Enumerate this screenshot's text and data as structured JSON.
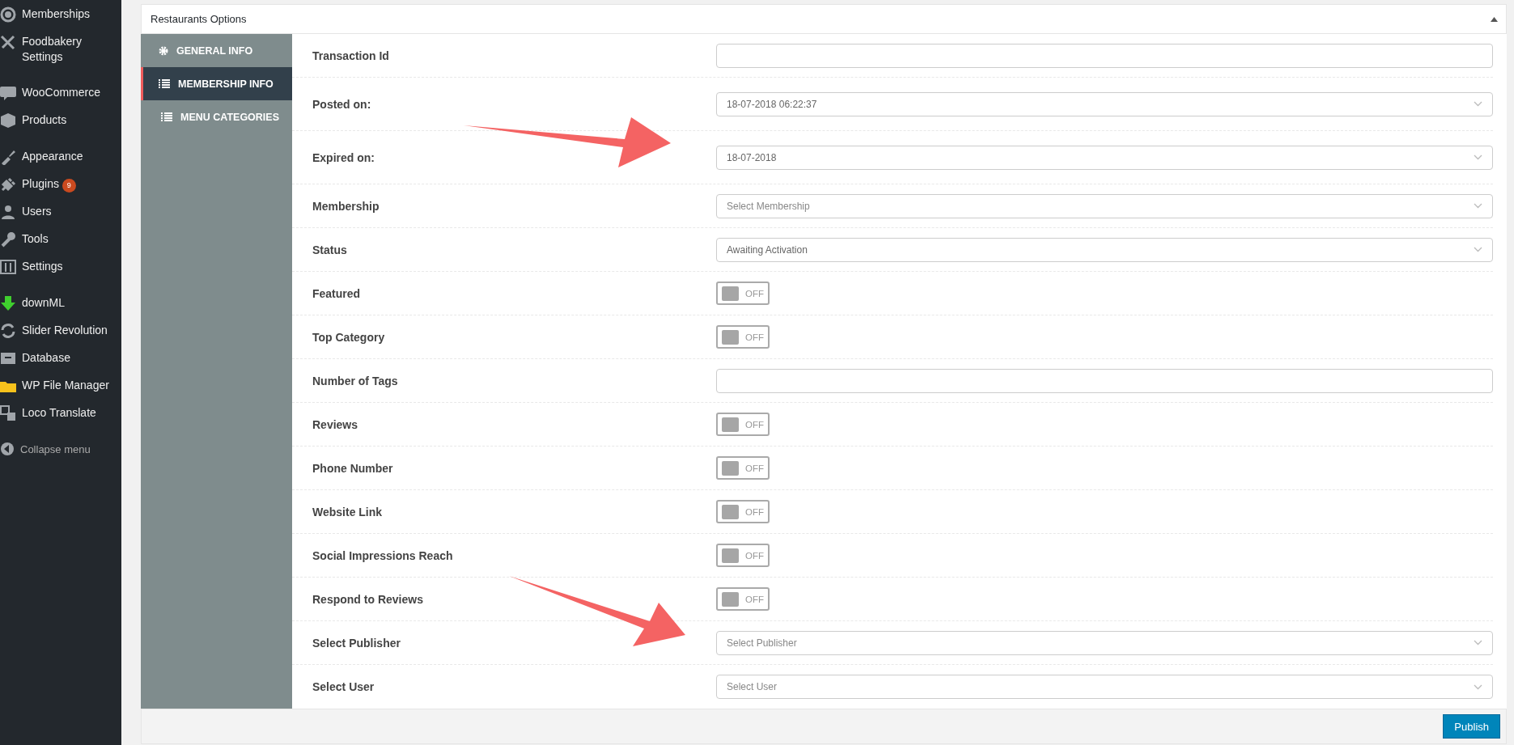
{
  "sidebar": {
    "groups": [
      [
        {
          "label": "Memberships"
        },
        {
          "label": "Foodbakery Settings"
        }
      ],
      [
        {
          "label": "WooCommerce"
        },
        {
          "label": "Products"
        }
      ],
      [
        {
          "label": "Appearance"
        },
        {
          "label": "Plugins",
          "badge": "9"
        },
        {
          "label": "Users"
        },
        {
          "label": "Tools"
        },
        {
          "label": "Settings"
        }
      ],
      [
        {
          "label": "downML"
        },
        {
          "label": "Slider Revolution"
        },
        {
          "label": "Database"
        },
        {
          "label": "WP File Manager"
        },
        {
          "label": "Loco Translate"
        }
      ]
    ],
    "collapse": "Collapse menu"
  },
  "panel": {
    "title": "Restaurants Options",
    "expanded": true,
    "tabs": [
      {
        "label": "GENERAL INFO",
        "selected": false
      },
      {
        "label": "MEMBERSHIP INFO",
        "selected": true
      },
      {
        "label": "MENU CATEGORIES",
        "selected": false
      }
    ],
    "rows": [
      {
        "kind": "text",
        "label": "Transaction Id"
      },
      {
        "kind": "select",
        "label": "Posted on:",
        "value": "18-07-2018 06:22:37"
      },
      {
        "kind": "select",
        "label": "Expired on:",
        "value": "18-07-2018"
      },
      {
        "kind": "select",
        "label": "Membership",
        "placeholder": "Select Membership"
      },
      {
        "kind": "select",
        "label": "Status",
        "value": "Awaiting Activation"
      },
      {
        "kind": "toggle",
        "label": "Featured",
        "on": false,
        "state_label": "OFF"
      },
      {
        "kind": "toggle",
        "label": "Top Category",
        "on": false,
        "state_label": "OFF"
      },
      {
        "kind": "text",
        "label": "Number of Tags"
      },
      {
        "kind": "toggle",
        "label": "Reviews",
        "on": false,
        "state_label": "OFF"
      },
      {
        "kind": "toggle",
        "label": "Phone Number",
        "on": false,
        "state_label": "OFF"
      },
      {
        "kind": "toggle",
        "label": "Website Link",
        "on": false,
        "state_label": "OFF"
      },
      {
        "kind": "toggle",
        "label": "Social Impressions Reach",
        "on": false,
        "state_label": "OFF"
      },
      {
        "kind": "toggle",
        "label": "Respond to Reviews",
        "on": false,
        "state_label": "OFF"
      },
      {
        "kind": "select",
        "label": "Select Publisher",
        "placeholder": "Select Publisher"
      },
      {
        "kind": "select",
        "label": "Select User",
        "placeholder": "Select User"
      }
    ]
  },
  "publish_button": "Publish"
}
